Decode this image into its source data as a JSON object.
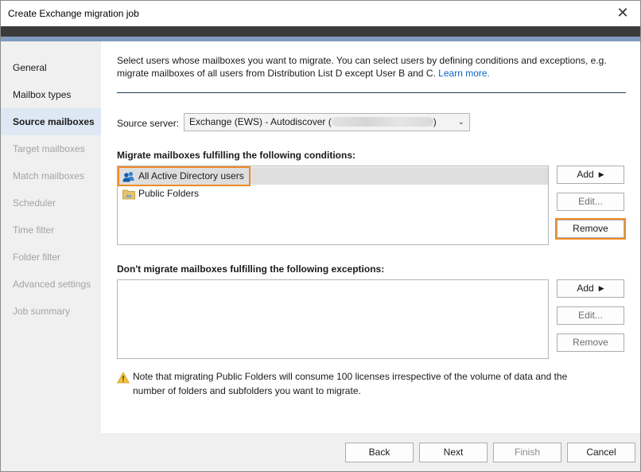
{
  "window": {
    "title": "Create Exchange migration job"
  },
  "sidebar": {
    "items": [
      {
        "label": "General",
        "state": "normal"
      },
      {
        "label": "Mailbox types",
        "state": "normal"
      },
      {
        "label": "Source mailboxes",
        "state": "active"
      },
      {
        "label": "Target mailboxes",
        "state": "disabled"
      },
      {
        "label": "Match mailboxes",
        "state": "disabled"
      },
      {
        "label": "Scheduler",
        "state": "disabled"
      },
      {
        "label": "Time filter",
        "state": "disabled"
      },
      {
        "label": "Folder filter",
        "state": "disabled"
      },
      {
        "label": "Advanced settings",
        "state": "disabled"
      },
      {
        "label": "Job summary",
        "state": "disabled"
      }
    ]
  },
  "main": {
    "intro_line1": "Select users whose mailboxes you want to migrate. You can select users by defining conditions and exceptions, e.g.",
    "intro_line2": "migrate mailboxes of all users from Distribution List D except User B and C.",
    "learn_more": "Learn more.",
    "source_server_label": "Source server:",
    "source_server_prefix": "Exchange (EWS) - Autodiscover (",
    "source_server_suffix": ")",
    "conditions_label": "Migrate mailboxes fulfilling the following conditions:",
    "conditions": [
      {
        "label": "All Active Directory users",
        "icon": "users-icon"
      },
      {
        "label": "Public Folders",
        "icon": "folder-icon"
      }
    ],
    "exceptions_label": "Don't migrate mailboxes fulfilling the following exceptions:",
    "exceptions": [],
    "add_label": "Add",
    "edit_label": "Edit...",
    "remove_label": "Remove",
    "note": "Note that migrating Public Folders will consume 100 licenses irrespective of the volume of data and the number of folders and subfolders you want to migrate."
  },
  "footer": {
    "back": "Back",
    "next": "Next",
    "finish": "Finish",
    "cancel": "Cancel"
  },
  "colors": {
    "highlight": "#f08a24",
    "link": "#0b62c4",
    "active_nav": "#dde8f4"
  }
}
